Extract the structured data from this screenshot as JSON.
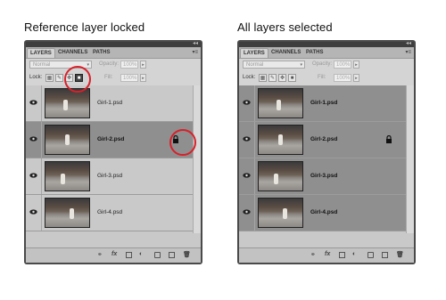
{
  "captions": {
    "left": "Reference layer locked",
    "right": "All layers selected"
  },
  "panels": [
    {
      "tabs": {
        "layers": "LAYERS",
        "channels": "CHANNELS",
        "paths": "PATHS"
      },
      "blend_mode": "Normal",
      "opacity_label": "Opacity:",
      "opacity_value": "100%",
      "lock_label": "Lock:",
      "fill_label": "Fill:",
      "fill_value": "100%",
      "layers": [
        {
          "name": "Girl-1.psd",
          "selected": false,
          "locked": false
        },
        {
          "name": "Girl-2.psd",
          "selected": true,
          "locked": true
        },
        {
          "name": "Girl-3.psd",
          "selected": false,
          "locked": false
        },
        {
          "name": "Girl-4.psd",
          "selected": false,
          "locked": false
        }
      ]
    },
    {
      "tabs": {
        "layers": "LAYERS",
        "channels": "CHANNELS",
        "paths": "PATHS"
      },
      "blend_mode": "Normal",
      "opacity_label": "Opacity:",
      "opacity_value": "100%",
      "lock_label": "Lock:",
      "fill_label": "Fill:",
      "fill_value": "100%",
      "layers": [
        {
          "name": "Girl-1.psd",
          "selected": true,
          "locked": false
        },
        {
          "name": "Girl-2.psd",
          "selected": true,
          "locked": true
        },
        {
          "name": "Girl-3.psd",
          "selected": true,
          "locked": false
        },
        {
          "name": "Girl-4.psd",
          "selected": true,
          "locked": false
        }
      ]
    }
  ],
  "footer_icons": [
    "link-icon",
    "fx-icon",
    "mask-icon",
    "adjustment-icon",
    "group-folder-icon",
    "new-layer-icon",
    "trash-icon"
  ],
  "colors": {
    "highlight_ring": "#d8202a",
    "selected_layer": "#8f8f8f"
  }
}
